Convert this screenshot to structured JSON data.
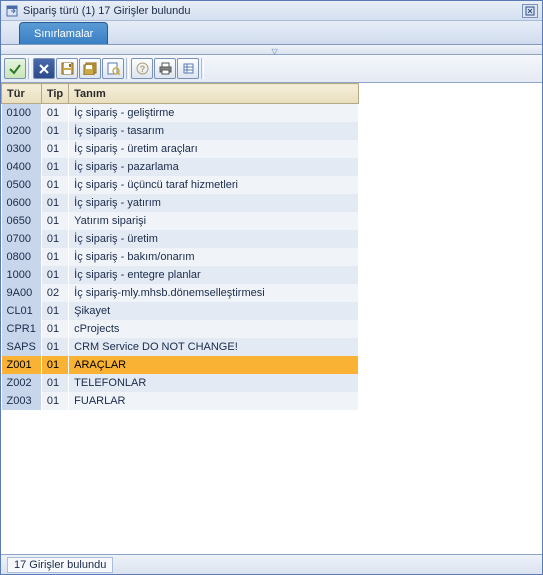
{
  "window": {
    "title": "Sipariş türü (1)   17 Girişler bulundu"
  },
  "tabs": {
    "restrictions": "Sınırlamalar"
  },
  "columns": {
    "type": "Tür",
    "kind": "Tip",
    "desc": "Tanım"
  },
  "rows": [
    {
      "tur": "0100",
      "tip": "01",
      "tanim": "İç sipariş - geliştirme"
    },
    {
      "tur": "0200",
      "tip": "01",
      "tanim": "İç sipariş - tasarım"
    },
    {
      "tur": "0300",
      "tip": "01",
      "tanim": "İç sipariş - üretim araçları"
    },
    {
      "tur": "0400",
      "tip": "01",
      "tanim": "İç sipariş - pazarlama"
    },
    {
      "tur": "0500",
      "tip": "01",
      "tanim": "İç sipariş - üçüncü taraf hizmetleri"
    },
    {
      "tur": "0600",
      "tip": "01",
      "tanim": "İç sipariş - yatırım"
    },
    {
      "tur": "0650",
      "tip": "01",
      "tanim": "Yatırım siparişi"
    },
    {
      "tur": "0700",
      "tip": "01",
      "tanim": "İç sipariş - üretim"
    },
    {
      "tur": "0800",
      "tip": "01",
      "tanim": "İç sipariş - bakım/onarım"
    },
    {
      "tur": "1000",
      "tip": "01",
      "tanim": "İç sipariş - entegre planlar"
    },
    {
      "tur": "9A00",
      "tip": "02",
      "tanim": "İç sipariş-mly.mhsb.dönemselleştirmesi"
    },
    {
      "tur": "CL01",
      "tip": "01",
      "tanim": "Şikayet"
    },
    {
      "tur": "CPR1",
      "tip": "01",
      "tanim": "cProjects"
    },
    {
      "tur": "SAPS",
      "tip": "01",
      "tanim": "CRM Service  DO NOT CHANGE!"
    },
    {
      "tur": "Z001",
      "tip": "01",
      "tanim": "ARAÇLAR",
      "selected": true
    },
    {
      "tur": "Z002",
      "tip": "01",
      "tanim": "TELEFONLAR"
    },
    {
      "tur": "Z003",
      "tip": "01",
      "tanim": "FUARLAR"
    }
  ],
  "status": {
    "text": "17 Girişler bulundu"
  }
}
